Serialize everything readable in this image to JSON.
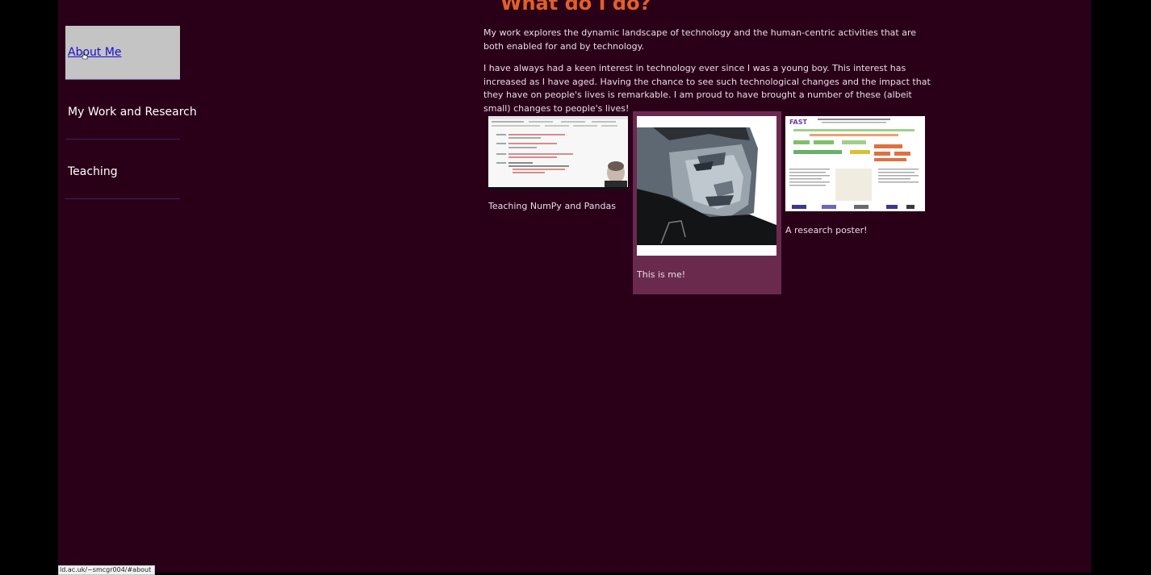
{
  "nav": {
    "items": [
      {
        "label": "About Me"
      },
      {
        "label": "My Work and Research"
      },
      {
        "label": "Teaching"
      }
    ]
  },
  "main": {
    "heading": "What do I do?",
    "paragraphs": [
      "My work explores the dynamic landscape of technology and the human-centric activities that are both enabled for and by technology.",
      "I have always had a keen interest in technology ever since I was a young boy. This interest has increased as I have aged. Having the chance to see such technological changes and the impact that they have on people's lives is remarkable. I am proud to have brought a number of these (albeit small) changes to people's lives!"
    ],
    "gallery": [
      {
        "caption": "Teaching NumPy and Pandas"
      },
      {
        "caption": "This is me!"
      },
      {
        "caption": "A research poster!"
      }
    ],
    "poster_logo": "FAST"
  },
  "status_bar": {
    "url": "ld.ac.uk/~smcgr004/#about"
  },
  "colors": {
    "page_bg": "#2a0019",
    "heading": "#e0602c",
    "active_nav_bg": "#c4c4c4",
    "link": "#1a0dcc",
    "highlight_card": "#6a2a4e"
  }
}
